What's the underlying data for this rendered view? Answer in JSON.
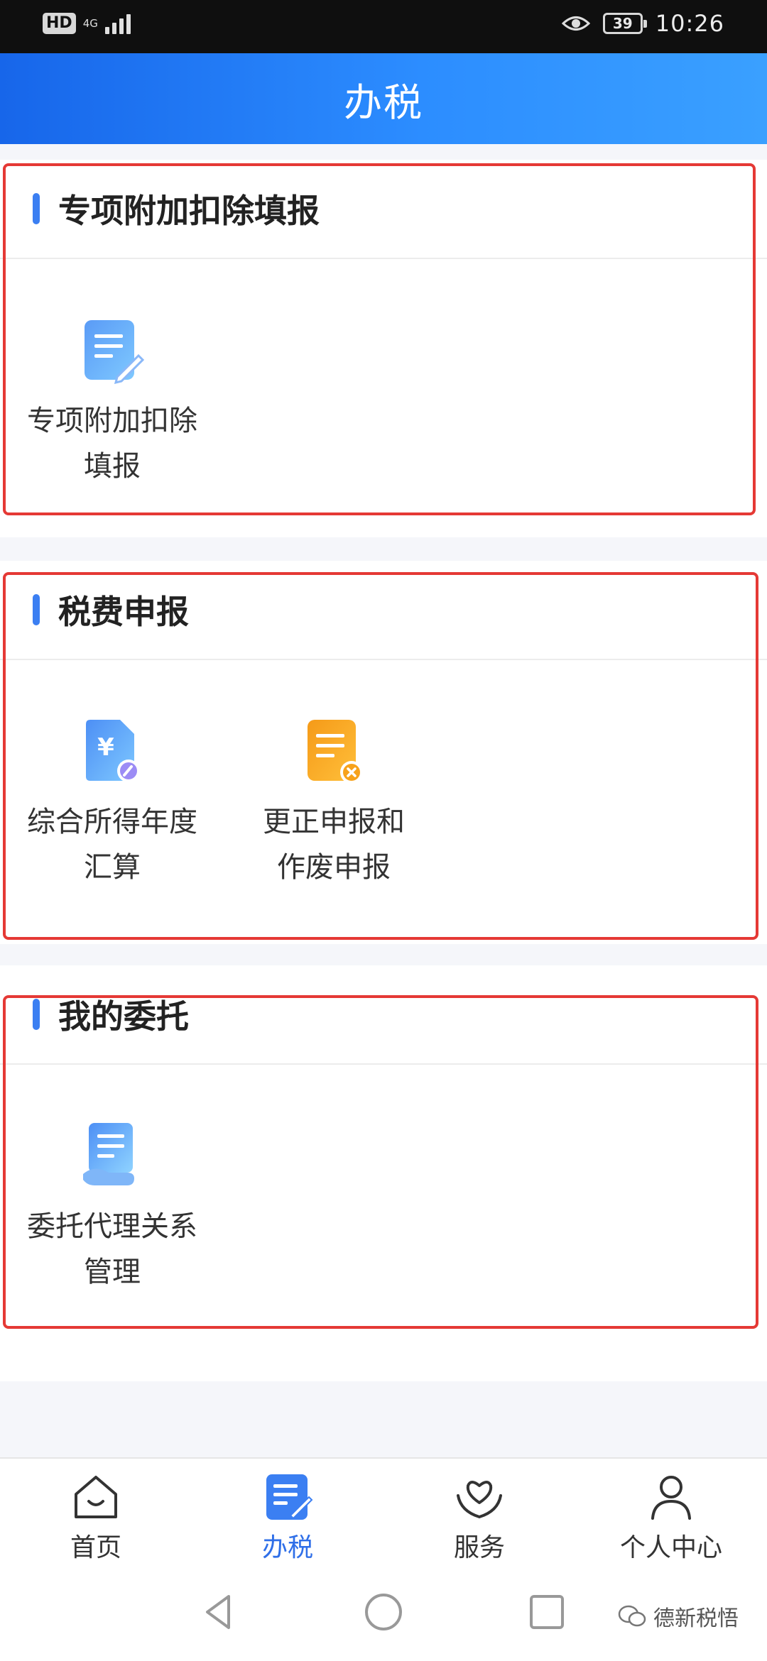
{
  "status_bar": {
    "hd": "HD",
    "network": "4G",
    "battery": "39",
    "time": "10:26"
  },
  "header": {
    "title": "办税"
  },
  "sections": [
    {
      "heading": "专项附加扣除填报",
      "items": [
        {
          "label": "专项附加扣除\n填报",
          "icon": "document-edit-icon"
        }
      ]
    },
    {
      "heading": "税费申报",
      "items": [
        {
          "label": "综合所得年度\n汇算",
          "icon": "yuan-document-icon"
        },
        {
          "label": "更正申报和\n作废申报",
          "icon": "document-cancel-icon"
        }
      ]
    },
    {
      "heading": "我的委托",
      "items": [
        {
          "label": "委托代理关系\n管理",
          "icon": "document-hand-icon"
        }
      ]
    }
  ],
  "bottom_nav": {
    "items": [
      {
        "label": "首页",
        "icon": "home-icon",
        "active": false
      },
      {
        "label": "办税",
        "icon": "tax-document-icon",
        "active": true
      },
      {
        "label": "服务",
        "icon": "heart-hands-icon",
        "active": false
      },
      {
        "label": "个人中心",
        "icon": "person-icon",
        "active": false
      }
    ]
  },
  "watermark": {
    "text": "德新税悟"
  },
  "colors": {
    "accent": "#2f6fe8",
    "header_start": "#1766ea",
    "header_end": "#3aa0ff",
    "highlight": "#e53935",
    "orange_icon": "#f7a21b"
  }
}
